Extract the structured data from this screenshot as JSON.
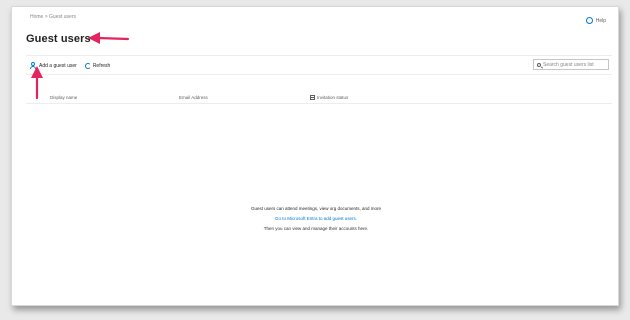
{
  "breadcrumb": "Home > Guest users",
  "help_label": "Help",
  "page_title": "Guest users",
  "toolbar": {
    "add_guest_label": "Add a guest user",
    "refresh_label": "Refresh"
  },
  "search": {
    "placeholder": "Search guest users list"
  },
  "table": {
    "columns": [
      "Display name",
      "Email Address",
      "Invitation status"
    ]
  },
  "empty_state": {
    "line1": "Guest users can attend meetings, view org documents, and more",
    "line2": "Go to Microsoft Entra to add guest users.",
    "line3": "Then you can view and manage their accounts here."
  },
  "colors": {
    "accent": "#0078d4",
    "annotation_arrow": "#e4245f",
    "text": "#201f1e"
  },
  "icons": [
    "help-icon",
    "person-add-icon",
    "refresh-icon",
    "search-icon",
    "calendar-icon"
  ]
}
